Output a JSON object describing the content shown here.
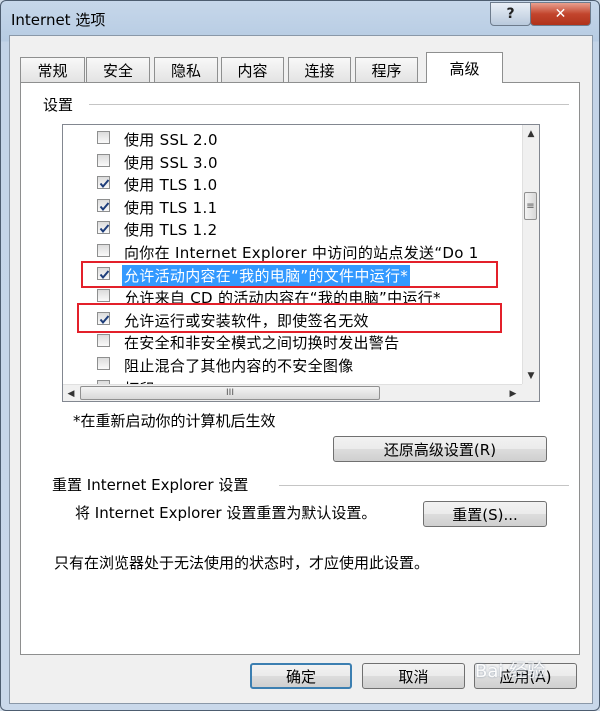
{
  "window": {
    "title": "Internet 选项",
    "help_label": "?",
    "close_label": "✕"
  },
  "tabs": [
    {
      "label": "常规",
      "active": false
    },
    {
      "label": "安全",
      "active": false
    },
    {
      "label": "隐私",
      "active": false
    },
    {
      "label": "内容",
      "active": false
    },
    {
      "label": "连接",
      "active": false
    },
    {
      "label": "程序",
      "active": false
    },
    {
      "label": "高级",
      "active": true
    }
  ],
  "settings": {
    "group_label": "设置",
    "items": [
      {
        "label": "使用 SSL 2.0",
        "checked": false
      },
      {
        "label": "使用 SSL 3.0",
        "checked": false
      },
      {
        "label": "使用 TLS 1.0",
        "checked": true
      },
      {
        "label": "使用 TLS 1.1",
        "checked": true
      },
      {
        "label": "使用 TLS 1.2",
        "checked": true
      },
      {
        "label": "向你在 Internet Explorer 中访问的站点发送“Do 1",
        "checked": false
      },
      {
        "label": "允许活动内容在“我的电脑”的文件中运行*",
        "checked": true,
        "selected": true
      },
      {
        "label": "允许来自 CD 的活动内容在“我的电脑”中运行*",
        "checked": false
      },
      {
        "label": "允许运行或安装软件，即使签名无效",
        "checked": true
      },
      {
        "label": "在安全和非安全模式之间切换时发出警告",
        "checked": false
      },
      {
        "label": "阻止混合了其他内容的不安全图像",
        "checked": false
      },
      {
        "label": "打印",
        "checked": false
      }
    ],
    "restart_note": "*在重新启动你的计算机后生效",
    "restore_button": "还原高级设置(R)"
  },
  "reset": {
    "group_label": "重置 Internet Explorer 设置",
    "description": "将 Internet Explorer 设置重置为默认设置。",
    "button": "重置(S)...",
    "warning": "只有在浏览器处于无法使用的状态时，才应使用此设置。"
  },
  "footer": {
    "ok": "确定",
    "cancel": "取消",
    "apply": "应用(A)"
  },
  "watermark": "Bai 经验",
  "colors": {
    "highlight_box": "#e3202a",
    "selection": "#3399ff"
  }
}
